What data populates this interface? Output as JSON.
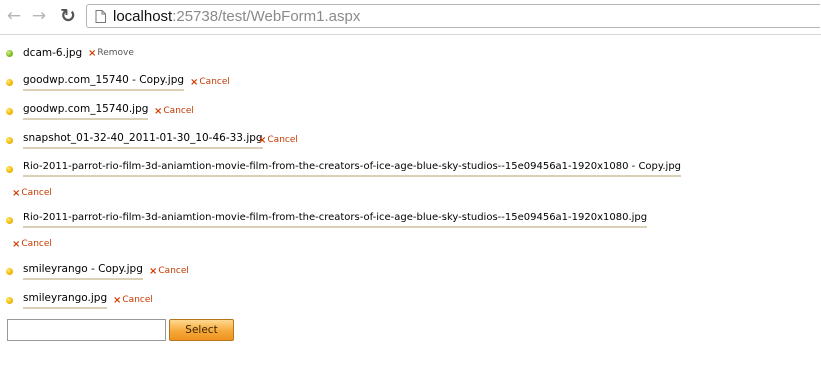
{
  "browser": {
    "url_host": "localhost",
    "url_rest": ":25738/test/WebForm1.aspx",
    "back_glyph": "←",
    "forward_glyph": "→",
    "reload_glyph": "↻"
  },
  "action_x": "×",
  "files": [
    {
      "name": "dcam-6.jpg",
      "status": "uploaded",
      "action": "Remove"
    },
    {
      "name": "goodwp.com_15740 - Copy.jpg",
      "status": "queued",
      "action": "Cancel"
    },
    {
      "name": "goodwp.com_15740.jpg",
      "status": "queued",
      "action": "Cancel"
    },
    {
      "name": "snapshot_01-32-40_2011-01-30_10-46-33.jpg",
      "status": "queued",
      "action": "Cancel"
    },
    {
      "name": "Rio-2011-parrot-rio-film-3d-aniamtion-movie-film-from-the-creators-of-ice-age-blue-sky-studios--15e09456a1-1920x1080 - Copy.jpg",
      "status": "queued",
      "action": "Cancel"
    },
    {
      "name": "Rio-2011-parrot-rio-film-3d-aniamtion-movie-film-from-the-creators-of-ice-age-blue-sky-studios--15e09456a1-1920x1080.jpg",
      "status": "queued",
      "action": "Cancel"
    },
    {
      "name": "smileyrango - Copy.jpg",
      "status": "queued",
      "action": "Cancel"
    },
    {
      "name": "smileyrango.jpg",
      "status": "queued",
      "action": "Cancel"
    }
  ],
  "upload": {
    "file_value": "",
    "select_label": "Select"
  },
  "colors": {
    "uploaded_bullet": "#7cbb1e",
    "queued_bullet": "#f0b800",
    "cancel_text": "#c63a00",
    "select_button": "#f6a93a"
  }
}
